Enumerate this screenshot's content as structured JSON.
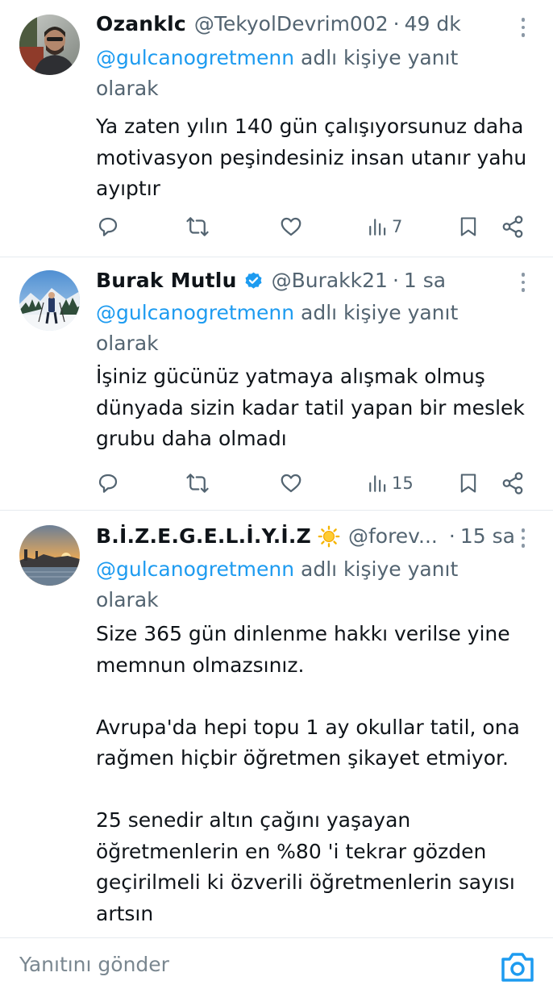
{
  "tweets": [
    {
      "name": "Ozanklc",
      "verified": false,
      "handle": "@TekyolDevrim002",
      "separator": "·",
      "time": "49 dk",
      "reply_mention": "@gulcanogretmenn",
      "reply_suffix": " adlı kişiye yanıt olarak",
      "text": "Ya zaten yılın 140 gün çalışıyorsunuz daha motivasyon peşindesiniz insan utanır yahu ayıptır",
      "views": "7"
    },
    {
      "name": "Burak Mutlu",
      "verified": true,
      "handle": "@Burakk21",
      "separator": "·",
      "time": "1 sa",
      "reply_mention": "@gulcanogretmenn",
      "reply_suffix": " adlı kişiye yanıt olarak",
      "text": "İşiniz gücünüz yatmaya alışmak olmuş dünyada sizin kadar tatil yapan bir meslek grubu daha olmadı",
      "views": "15"
    },
    {
      "name": "B.İ.Z.E.G.E.L.İ.Y.İ.Z",
      "verified": false,
      "emoji": "sun-icon",
      "handle": "@forev...",
      "separator": "·",
      "time": "15 sa",
      "reply_mention": "@gulcanogretmenn",
      "reply_suffix": " adlı kişiye yanıt olarak",
      "text": "Size 365 gün dinlenme hakkı verilse yine memnun olmazsınız.\n\nAvrupa'da hepi topu 1 ay okullar tatil, ona rağmen hiçbir öğretmen şikayet etmiyor.\n\n25 senedir altın çağını yaşayan öğretmenlerin en %80 'i tekrar gözden geçirilmeli ki özverili öğretmenlerin sayısı artsın"
    }
  ],
  "composer": {
    "placeholder": "Yanıtını gönder"
  },
  "icons": {
    "reply": "reply-icon",
    "retweet": "retweet-icon",
    "like": "heart-icon",
    "views": "views-icon",
    "bookmark": "bookmark-icon",
    "share": "share-icon",
    "more": "more-icon",
    "camera": "camera-icon"
  },
  "colors": {
    "accent": "#1d9bf0",
    "secondary_text": "#536471",
    "primary_text": "#0f1419"
  }
}
